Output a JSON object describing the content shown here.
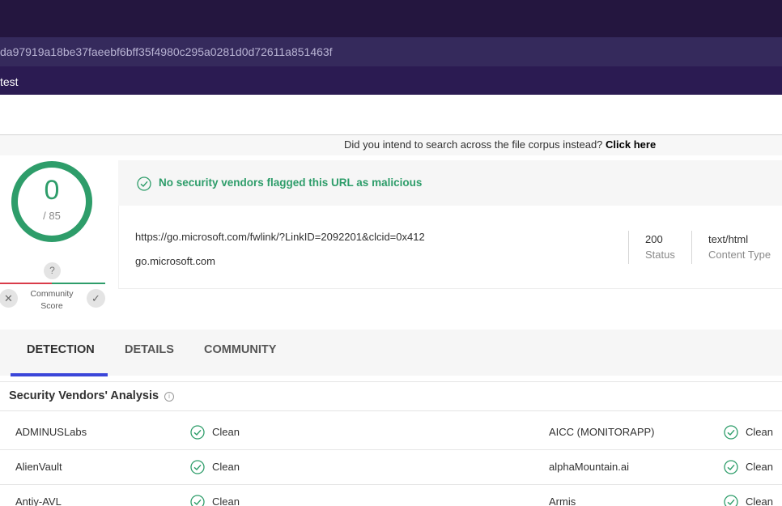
{
  "header": {
    "hash": "da97919a18be37faeebf6bff35f4980c295a0281d0d72611a851463f",
    "tag": "test"
  },
  "hint": {
    "text": "Did you intend to search across the file corpus instead?",
    "link": "Click here"
  },
  "score": {
    "detections": "0",
    "total": "/ 85",
    "community_q": "?",
    "community_label_1": "Community",
    "community_label_2": "Score",
    "downvote": "✕",
    "upvote": "✓"
  },
  "verdict": {
    "message": "No security vendors flagged this URL as malicious",
    "color": "#2e9d6a"
  },
  "url": {
    "full": "https://go.microsoft.com/fwlink/?LinkID=2092201&clcid=0x412",
    "domain": "go.microsoft.com",
    "status_value": "200",
    "status_label": "Status",
    "content_type_value": "text/html",
    "content_type_label": "Content Type"
  },
  "tabs": {
    "detection": "DETECTION",
    "details": "DETAILS",
    "community": "COMMUNITY",
    "active_color": "#3b46d9"
  },
  "analysis": {
    "title": "Security Vendors' Analysis",
    "rows": [
      {
        "left_vendor": "ADMINUSLabs",
        "left_result": "Clean",
        "right_vendor": "AICC (MONITORAPP)",
        "right_result": "Clean"
      },
      {
        "left_vendor": "AlienVault",
        "left_result": "Clean",
        "right_vendor": "alphaMountain.ai",
        "right_result": "Clean"
      },
      {
        "left_vendor": "Antiy-AVL",
        "left_result": "Clean",
        "right_vendor": "Armis",
        "right_result": "Clean"
      }
    ]
  }
}
